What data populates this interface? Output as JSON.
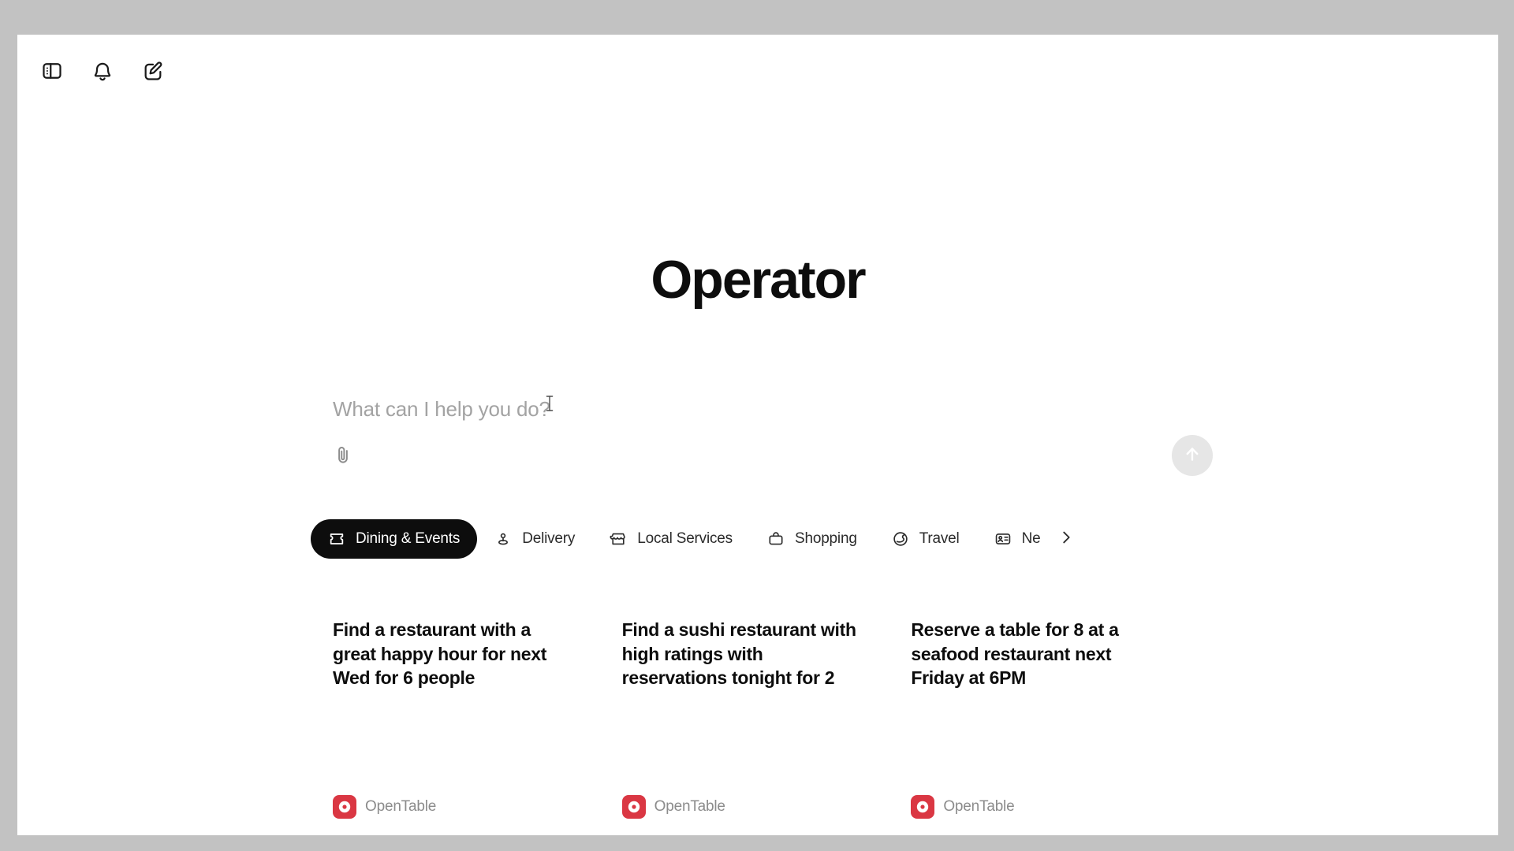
{
  "window": {
    "background_outer": "#c2c2c2",
    "background_inner": "#ffffff"
  },
  "top_bar": {
    "buttons": [
      {
        "name": "sidebar-toggle-icon",
        "label": "Toggle sidebar"
      },
      {
        "name": "notifications-bell-icon",
        "label": "Notifications"
      },
      {
        "name": "new-chat-compose-icon",
        "label": "New chat"
      }
    ]
  },
  "hero": {
    "title": "Operator"
  },
  "composer": {
    "placeholder": "What can I help you do?",
    "value": "",
    "attach_label": "Attach file",
    "send_label": "Send",
    "send_disabled_color": "#e6e6e6"
  },
  "categories": {
    "next_label": "Scroll categories right",
    "items": [
      {
        "label": "Dining & Events",
        "icon": "ticket-icon",
        "active": true
      },
      {
        "label": "Delivery",
        "icon": "location-pin-icon",
        "active": false
      },
      {
        "label": "Local Services",
        "icon": "storefront-icon",
        "active": false
      },
      {
        "label": "Shopping",
        "icon": "shopping-bag-icon",
        "active": false
      },
      {
        "label": "Travel",
        "icon": "globe-icon",
        "active": false
      },
      {
        "label": "Ne",
        "icon": "news-card-icon",
        "active": false
      }
    ]
  },
  "suggestions": {
    "accent_color": "#da3743",
    "cards": [
      {
        "text": "Find a restaurant with a great happy hour for next Wed for 6 people",
        "source": "OpenTable"
      },
      {
        "text": "Find a sushi restaurant with high ratings with reservations tonight for 2",
        "source": "OpenTable"
      },
      {
        "text": "Reserve a table for 8 at a seafood restaurant next Friday at 6PM",
        "source": "OpenTable"
      }
    ]
  }
}
